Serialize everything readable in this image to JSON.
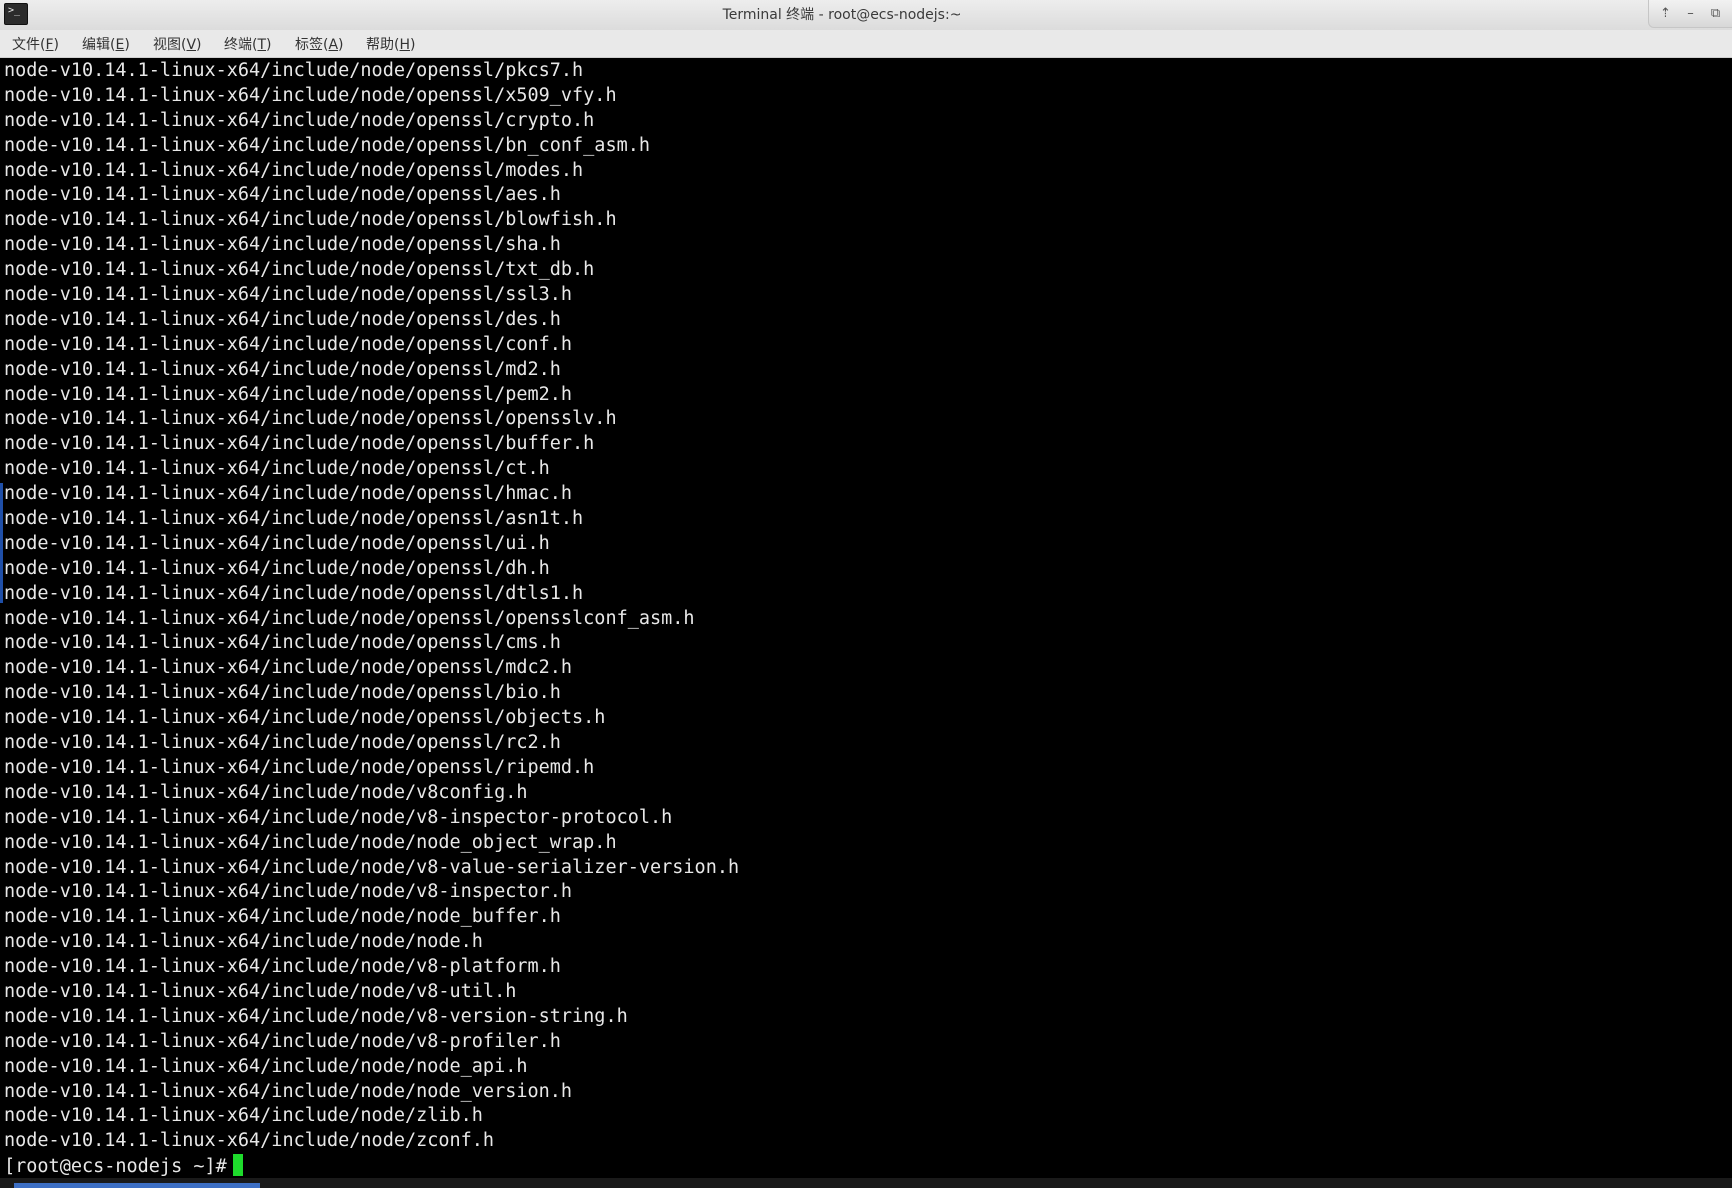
{
  "window": {
    "title": "Terminal 终端 - root@ecs-nodejs:~",
    "app_icon_glyph": ">_",
    "controls": {
      "up_glyph": "⇡",
      "minimize_glyph": "–",
      "maximize_glyph": "⧉"
    }
  },
  "menu": {
    "items": [
      {
        "label": "文件(",
        "mnemonic": "F",
        "end": ")"
      },
      {
        "label": "编辑(",
        "mnemonic": "E",
        "end": ")"
      },
      {
        "label": "视图(",
        "mnemonic": "V",
        "end": ")"
      },
      {
        "label": "终端(",
        "mnemonic": "T",
        "end": ")"
      },
      {
        "label": "标签(",
        "mnemonic": "A",
        "end": ")"
      },
      {
        "label": "帮助(",
        "mnemonic": "H",
        "end": ")"
      }
    ]
  },
  "terminal": {
    "lines": [
      "node-v10.14.1-linux-x64/include/node/openssl/pkcs7.h",
      "node-v10.14.1-linux-x64/include/node/openssl/x509_vfy.h",
      "node-v10.14.1-linux-x64/include/node/openssl/crypto.h",
      "node-v10.14.1-linux-x64/include/node/openssl/bn_conf_asm.h",
      "node-v10.14.1-linux-x64/include/node/openssl/modes.h",
      "node-v10.14.1-linux-x64/include/node/openssl/aes.h",
      "node-v10.14.1-linux-x64/include/node/openssl/blowfish.h",
      "node-v10.14.1-linux-x64/include/node/openssl/sha.h",
      "node-v10.14.1-linux-x64/include/node/openssl/txt_db.h",
      "node-v10.14.1-linux-x64/include/node/openssl/ssl3.h",
      "node-v10.14.1-linux-x64/include/node/openssl/des.h",
      "node-v10.14.1-linux-x64/include/node/openssl/conf.h",
      "node-v10.14.1-linux-x64/include/node/openssl/md2.h",
      "node-v10.14.1-linux-x64/include/node/openssl/pem2.h",
      "node-v10.14.1-linux-x64/include/node/openssl/opensslv.h",
      "node-v10.14.1-linux-x64/include/node/openssl/buffer.h",
      "node-v10.14.1-linux-x64/include/node/openssl/ct.h",
      "node-v10.14.1-linux-x64/include/node/openssl/hmac.h",
      "node-v10.14.1-linux-x64/include/node/openssl/asn1t.h",
      "node-v10.14.1-linux-x64/include/node/openssl/ui.h",
      "node-v10.14.1-linux-x64/include/node/openssl/dh.h",
      "node-v10.14.1-linux-x64/include/node/openssl/dtls1.h",
      "node-v10.14.1-linux-x64/include/node/openssl/opensslconf_asm.h",
      "node-v10.14.1-linux-x64/include/node/openssl/cms.h",
      "node-v10.14.1-linux-x64/include/node/openssl/mdc2.h",
      "node-v10.14.1-linux-x64/include/node/openssl/bio.h",
      "node-v10.14.1-linux-x64/include/node/openssl/objects.h",
      "node-v10.14.1-linux-x64/include/node/openssl/rc2.h",
      "node-v10.14.1-linux-x64/include/node/openssl/ripemd.h",
      "node-v10.14.1-linux-x64/include/node/v8config.h",
      "node-v10.14.1-linux-x64/include/node/v8-inspector-protocol.h",
      "node-v10.14.1-linux-x64/include/node/node_object_wrap.h",
      "node-v10.14.1-linux-x64/include/node/v8-value-serializer-version.h",
      "node-v10.14.1-linux-x64/include/node/v8-inspector.h",
      "node-v10.14.1-linux-x64/include/node/node_buffer.h",
      "node-v10.14.1-linux-x64/include/node/node.h",
      "node-v10.14.1-linux-x64/include/node/v8-platform.h",
      "node-v10.14.1-linux-x64/include/node/v8-util.h",
      "node-v10.14.1-linux-x64/include/node/v8-version-string.h",
      "node-v10.14.1-linux-x64/include/node/v8-profiler.h",
      "node-v10.14.1-linux-x64/include/node/node_api.h",
      "node-v10.14.1-linux-x64/include/node/node_version.h",
      "node-v10.14.1-linux-x64/include/node/zlib.h",
      "node-v10.14.1-linux-x64/include/node/zconf.h"
    ],
    "prompt": "[root@ecs-nodejs ~]#",
    "cursor_color": "#1edb2c",
    "foreground_color": "#e8e8e8",
    "background_color": "#000000"
  }
}
